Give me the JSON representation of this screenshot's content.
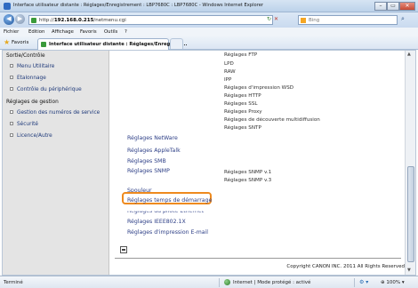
{
  "window": {
    "title": "Interface utilisateur distante : Réglages/Enregistrement : LBP7680C : LBP7680C - Windows Internet Explorer",
    "buttons": [
      "–",
      "▭",
      "✕"
    ]
  },
  "address": {
    "url_prefix": "http://",
    "url_host": "192.168.0.215",
    "url_path": "/netmenu.cgi",
    "refresh_glyph": "↻",
    "stop_glyph": "✕",
    "search_placeholder": "Bing",
    "search_glyph": "⌕"
  },
  "menu": [
    "Fichier",
    "Edition",
    "Affichage",
    "Favoris",
    "Outils",
    "?"
  ],
  "favorites": {
    "label": "Favoris",
    "tab_label": "Interface utilisateur distante : Réglages/Enregistre..."
  },
  "sidebar": {
    "sections": [
      {
        "title": "Sortie/Contrôle",
        "items": [
          "Menu Utilitaire",
          "Etalonnage",
          "Contrôle du périphérique"
        ]
      },
      {
        "title": "Réglages de gestion",
        "items": [
          "Gestion des numéros de service",
          "Sécurité",
          "Licence/Autre"
        ]
      }
    ]
  },
  "main": {
    "tcpip_sublist": [
      "Réglages FTP",
      "LPD",
      "RAW",
      "IPP",
      "Réglages d'impression WSD",
      "Réglages HTTP",
      "Réglages SSL",
      "Réglages Proxy",
      "Réglages de découverte multidiffusion",
      "Réglages SNTP"
    ],
    "links": [
      "Réglages NetWare",
      "Réglages AppleTalk",
      "Réglages SMB",
      "Réglages SNMP",
      "Spouleur",
      "Réglages temps de démarrage",
      "Réglages du pilote Ethernet",
      "Réglages IEEE802.1X",
      "Réglages d'impression E-mail"
    ],
    "snmp_sublist": [
      "Réglages SNMP v.1",
      "Réglages SNMP v.3"
    ],
    "copyright": "Copyright CANON INC. 2011 All Rights Reserved"
  },
  "status": {
    "text": "Terminé",
    "zone": "Internet | Mode protégé : activé",
    "zoom": "100%"
  },
  "colors": {
    "highlight": "#ee8a1e",
    "link": "#2c3e86",
    "sidebar_bg": "#e4e4e4"
  }
}
